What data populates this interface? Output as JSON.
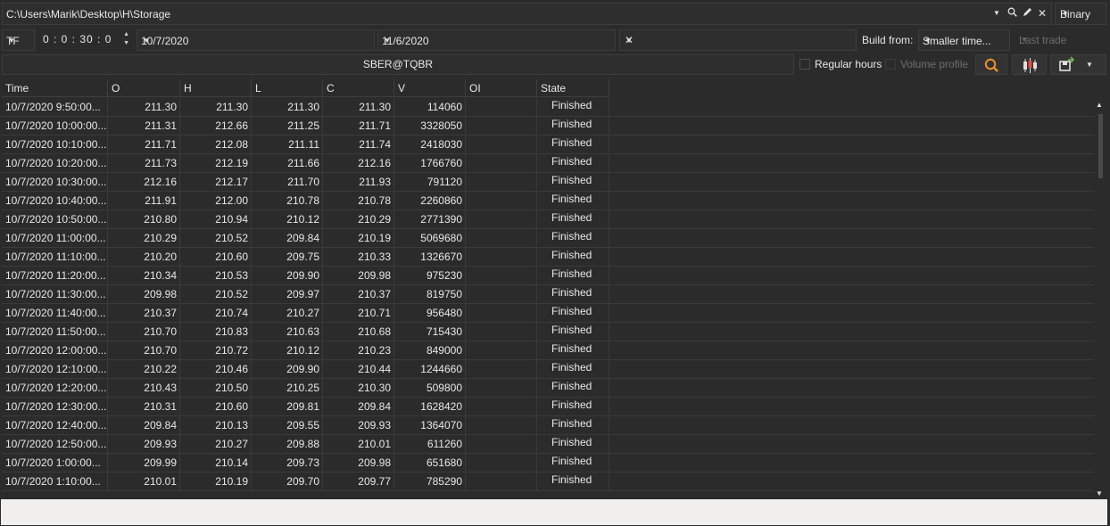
{
  "toolbar": {
    "path": "C:\\Users\\Marik\\Desktop\\H\\Storage",
    "format": "Binary",
    "timeframe": "TF",
    "time_value": "0 : 0 : 30 : 0",
    "date_from": "10/7/2020",
    "date_to": "11/6/2020",
    "extra_combo": "",
    "build_from_label": "Build from:",
    "build_from_value": "Smaller time...",
    "last_trade": "Last trade"
  },
  "filter": {
    "symbol": "SBER@TQBR",
    "regular_hours": "Regular hours",
    "volume_profile": "Volume profile"
  },
  "icons": {
    "accent_color": "#f0902a",
    "names": [
      "dropdown-arrow-icon",
      "search-icon",
      "pencil-icon",
      "close-icon",
      "candlestick-icon",
      "save-icon",
      "spin-arrows-icon"
    ]
  },
  "table": {
    "columns": [
      "Time",
      "O",
      "H",
      "L",
      "C",
      "V",
      "OI",
      "State"
    ],
    "rows": [
      {
        "time": "10/7/2020 9:50:00...",
        "o": "211.30",
        "h": "211.30",
        "l": "211.30",
        "c": "211.30",
        "v": "114060",
        "oi": "",
        "state": "Finished"
      },
      {
        "time": "10/7/2020 10:00:00...",
        "o": "211.31",
        "h": "212.66",
        "l": "211.25",
        "c": "211.71",
        "v": "3328050",
        "oi": "",
        "state": "Finished"
      },
      {
        "time": "10/7/2020 10:10:00...",
        "o": "211.71",
        "h": "212.08",
        "l": "211.11",
        "c": "211.74",
        "v": "2418030",
        "oi": "",
        "state": "Finished"
      },
      {
        "time": "10/7/2020 10:20:00...",
        "o": "211.73",
        "h": "212.19",
        "l": "211.66",
        "c": "212.16",
        "v": "1766760",
        "oi": "",
        "state": "Finished"
      },
      {
        "time": "10/7/2020 10:30:00...",
        "o": "212.16",
        "h": "212.17",
        "l": "211.70",
        "c": "211.93",
        "v": "791120",
        "oi": "",
        "state": "Finished"
      },
      {
        "time": "10/7/2020 10:40:00...",
        "o": "211.91",
        "h": "212.00",
        "l": "210.78",
        "c": "210.78",
        "v": "2260860",
        "oi": "",
        "state": "Finished"
      },
      {
        "time": "10/7/2020 10:50:00...",
        "o": "210.80",
        "h": "210.94",
        "l": "210.12",
        "c": "210.29",
        "v": "2771390",
        "oi": "",
        "state": "Finished"
      },
      {
        "time": "10/7/2020 11:00:00...",
        "o": "210.29",
        "h": "210.52",
        "l": "209.84",
        "c": "210.19",
        "v": "5069680",
        "oi": "",
        "state": "Finished"
      },
      {
        "time": "10/7/2020 11:10:00...",
        "o": "210.20",
        "h": "210.60",
        "l": "209.75",
        "c": "210.33",
        "v": "1326670",
        "oi": "",
        "state": "Finished"
      },
      {
        "time": "10/7/2020 11:20:00...",
        "o": "210.34",
        "h": "210.53",
        "l": "209.90",
        "c": "209.98",
        "v": "975230",
        "oi": "",
        "state": "Finished"
      },
      {
        "time": "10/7/2020 11:30:00...",
        "o": "209.98",
        "h": "210.52",
        "l": "209.97",
        "c": "210.37",
        "v": "819750",
        "oi": "",
        "state": "Finished"
      },
      {
        "time": "10/7/2020 11:40:00...",
        "o": "210.37",
        "h": "210.74",
        "l": "210.27",
        "c": "210.71",
        "v": "956480",
        "oi": "",
        "state": "Finished"
      },
      {
        "time": "10/7/2020 11:50:00...",
        "o": "210.70",
        "h": "210.83",
        "l": "210.63",
        "c": "210.68",
        "v": "715430",
        "oi": "",
        "state": "Finished"
      },
      {
        "time": "10/7/2020 12:00:00...",
        "o": "210.70",
        "h": "210.72",
        "l": "210.12",
        "c": "210.23",
        "v": "849000",
        "oi": "",
        "state": "Finished"
      },
      {
        "time": "10/7/2020 12:10:00...",
        "o": "210.22",
        "h": "210.46",
        "l": "209.90",
        "c": "210.44",
        "v": "1244660",
        "oi": "",
        "state": "Finished"
      },
      {
        "time": "10/7/2020 12:20:00...",
        "o": "210.43",
        "h": "210.50",
        "l": "210.25",
        "c": "210.30",
        "v": "509800",
        "oi": "",
        "state": "Finished"
      },
      {
        "time": "10/7/2020 12:30:00...",
        "o": "210.31",
        "h": "210.60",
        "l": "209.81",
        "c": "209.84",
        "v": "1628420",
        "oi": "",
        "state": "Finished"
      },
      {
        "time": "10/7/2020 12:40:00...",
        "o": "209.84",
        "h": "210.13",
        "l": "209.55",
        "c": "209.93",
        "v": "1364070",
        "oi": "",
        "state": "Finished"
      },
      {
        "time": "10/7/2020 12:50:00...",
        "o": "209.93",
        "h": "210.27",
        "l": "209.88",
        "c": "210.01",
        "v": "611260",
        "oi": "",
        "state": "Finished"
      },
      {
        "time": "10/7/2020 1:00:00...",
        "o": "209.99",
        "h": "210.14",
        "l": "209.73",
        "c": "209.98",
        "v": "651680",
        "oi": "",
        "state": "Finished"
      },
      {
        "time": "10/7/2020 1:10:00...",
        "o": "210.01",
        "h": "210.19",
        "l": "209.70",
        "c": "209.77",
        "v": "785290",
        "oi": "",
        "state": "Finished"
      }
    ]
  }
}
